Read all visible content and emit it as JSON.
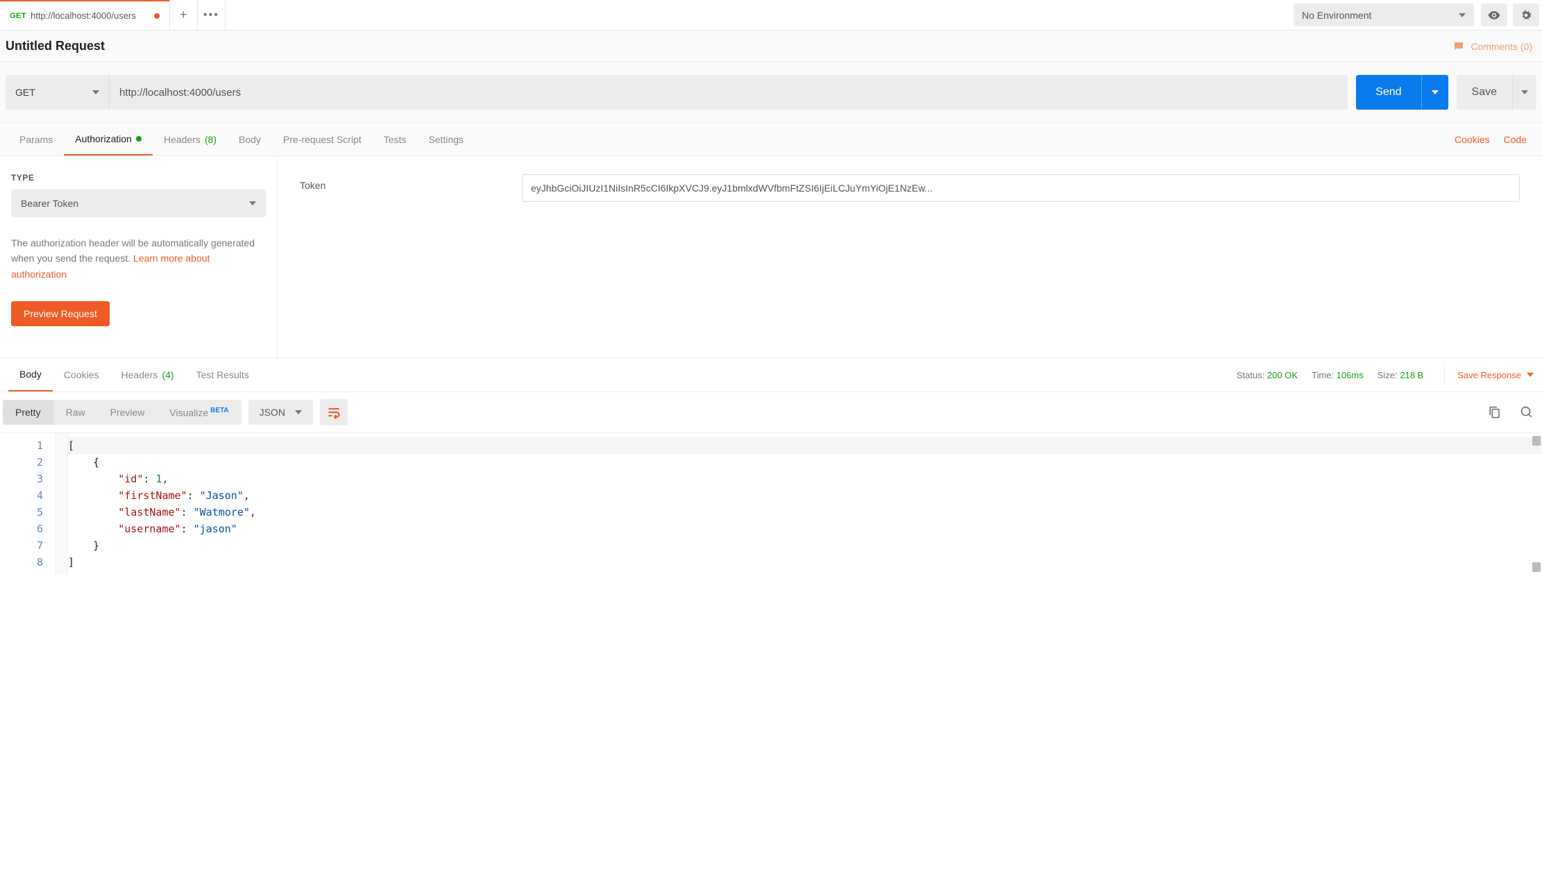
{
  "tab": {
    "method": "GET",
    "title": "http://localhost:4000/users"
  },
  "environment": {
    "selected": "No Environment"
  },
  "request_title": "Untitled Request",
  "comments": {
    "label": "Comments (0)"
  },
  "request": {
    "method": "GET",
    "url": "http://localhost:4000/users",
    "send_label": "Send",
    "save_label": "Save"
  },
  "reqtabs": {
    "params": "Params",
    "authorization": "Authorization",
    "headers": "Headers",
    "headers_count": "(8)",
    "body": "Body",
    "prerequest": "Pre-request Script",
    "tests": "Tests",
    "settings": "Settings",
    "cookies": "Cookies",
    "code": "Code"
  },
  "auth": {
    "type_label": "TYPE",
    "type_selected": "Bearer Token",
    "desc_1": "The authorization header will be automatically generated when you send the request. ",
    "learn": "Learn more about authorization",
    "preview": "Preview Request",
    "token_label": "Token",
    "token_value": "eyJhbGciOiJIUzI1NiIsInR5cCI6IkpXVCJ9.eyJ1bmlxdWVfbmFtZSI6IjEiLCJuYmYiOjE1NzEw..."
  },
  "resptabs": {
    "body": "Body",
    "cookies": "Cookies",
    "headers": "Headers",
    "headers_count": "(4)",
    "test_results": "Test Results"
  },
  "status": {
    "status_k": "Status:",
    "status_v": "200 OK",
    "time_k": "Time:",
    "time_v": "106ms",
    "size_k": "Size:",
    "size_v": "218 B",
    "save_response": "Save Response"
  },
  "viewrow": {
    "pretty": "Pretty",
    "raw": "Raw",
    "preview": "Preview",
    "visualize": "Visualize",
    "beta": "BETA",
    "json": "JSON"
  },
  "code_lines": {
    "l1": "[",
    "l2": "    {",
    "l3a": "        \"id\"",
    "l3b": ": ",
    "l3c": "1",
    "l3d": ",",
    "l4a": "        \"firstName\"",
    "l4b": ": ",
    "l4c": "\"Jason\"",
    "l4d": ",",
    "l5a": "        \"lastName\"",
    "l5b": ": ",
    "l5c": "\"Watmore\"",
    "l5d": ",",
    "l6a": "        \"username\"",
    "l6b": ": ",
    "l6c": "\"jason\"",
    "l7": "    }",
    "l8": "]"
  },
  "line_numbers": [
    "1",
    "2",
    "3",
    "4",
    "5",
    "6",
    "7",
    "8"
  ]
}
